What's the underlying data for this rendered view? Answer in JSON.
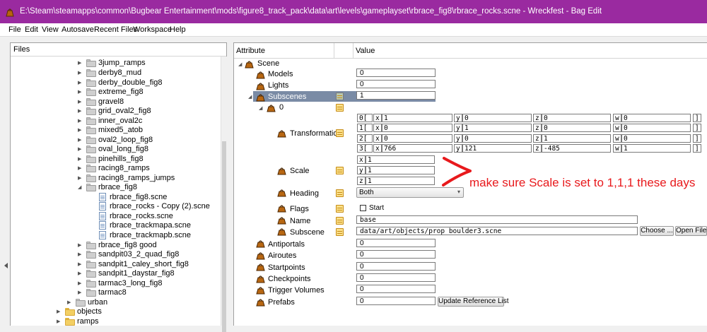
{
  "window": {
    "title": "E:\\Steam\\steamapps\\common\\Bugbear Entertainment\\mods\\figure8_track_pack\\data\\art\\levels\\gameplayset\\rbrace_fig8\\rbrace_rocks.scne - Wreckfest - Bag Edit"
  },
  "menu": [
    "File",
    "Edit",
    "View",
    "Autosave",
    "Recent Files",
    "Workspace",
    "Help"
  ],
  "files_panel": {
    "header": "Files",
    "items": [
      {
        "label": "3jump_ramps"
      },
      {
        "label": "derby8_mud"
      },
      {
        "label": "derby_double_fig8"
      },
      {
        "label": "extreme_fig8"
      },
      {
        "label": "gravel8"
      },
      {
        "label": "grid_oval2_fig8"
      },
      {
        "label": "inner_oval2c"
      },
      {
        "label": "mixed5_atob"
      },
      {
        "label": "oval2_loop_fig8"
      },
      {
        "label": "oval_long_fig8"
      },
      {
        "label": "pinehills_fig8"
      },
      {
        "label": "racing8_ramps"
      },
      {
        "label": "racing8_ramps_jumps"
      },
      {
        "label": "rbrace_fig8"
      },
      {
        "label": "rbrace_fig8.scne"
      },
      {
        "label": "rbrace_rocks - Copy (2).scne"
      },
      {
        "label": "rbrace_rocks.scne"
      },
      {
        "label": "rbrace_trackmapa.scne"
      },
      {
        "label": "rbrace_trackmapb.scne"
      },
      {
        "label": "rbrace_fig8 good"
      },
      {
        "label": "sandpit03_2_quad_fig8"
      },
      {
        "label": "sandpit1_caley_short_fig8"
      },
      {
        "label": "sandpit1_daystar_fig8"
      },
      {
        "label": "tarmac3_long_fig8"
      },
      {
        "label": "tarmac8"
      },
      {
        "label": "urban"
      },
      {
        "label": "objects"
      },
      {
        "label": "ramps"
      }
    ]
  },
  "attr_panel": {
    "col_attribute": "Attribute",
    "col_value": "Value",
    "scene": "Scene",
    "models": {
      "label": "Models",
      "value": "0"
    },
    "lights": {
      "label": "Lights",
      "value": "0"
    },
    "subscenes": {
      "label": "Subscenes",
      "value": "1"
    },
    "item0": "0",
    "transformation": {
      "label": "Transformation",
      "rows": [
        {
          "idx": "0[",
          "x": "1",
          "y": "0",
          "z": "0",
          "w": "0"
        },
        {
          "idx": "1[",
          "x": "0",
          "y": "1",
          "z": "0",
          "w": "0"
        },
        {
          "idx": "2[",
          "x": "0",
          "y": "0",
          "z": "1",
          "w": "0"
        },
        {
          "idx": "3[",
          "x": "766",
          "y": "121",
          "z": "-485",
          "w": "1"
        }
      ],
      "close": "]",
      "axes": {
        "x": "x",
        "y": "y",
        "z": "z",
        "w": "w"
      }
    },
    "scale": {
      "label": "Scale",
      "x": "1",
      "y": "1",
      "z": "1"
    },
    "heading": {
      "label": "Heading",
      "value": "Both"
    },
    "flags": {
      "label": "Flags",
      "start": "Start"
    },
    "name": {
      "label": "Name",
      "value": "base"
    },
    "subscene": {
      "label": "Subscene",
      "value": "data/art/objects/prop_boulder3.scne",
      "choose": "Choose ...",
      "open": "Open File"
    },
    "antiportals": {
      "label": "Antiportals",
      "value": "0"
    },
    "airoutes": {
      "label": "Airoutes",
      "value": "0"
    },
    "startpoints": {
      "label": "Startpoints",
      "value": "0"
    },
    "checkpoints": {
      "label": "Checkpoints",
      "value": "0"
    },
    "triggers": {
      "label": "Trigger Volumes",
      "value": "0"
    },
    "prefabs": {
      "label": "Prefabs",
      "value": "0",
      "update": "Update Reference List"
    }
  },
  "annotation": {
    "text": "make sure Scale is set to 1,1,1 these days",
    "color": "#e8191c"
  },
  "colors": {
    "titlebar": "#9a2aa0",
    "selection": "#7a8ba5"
  }
}
